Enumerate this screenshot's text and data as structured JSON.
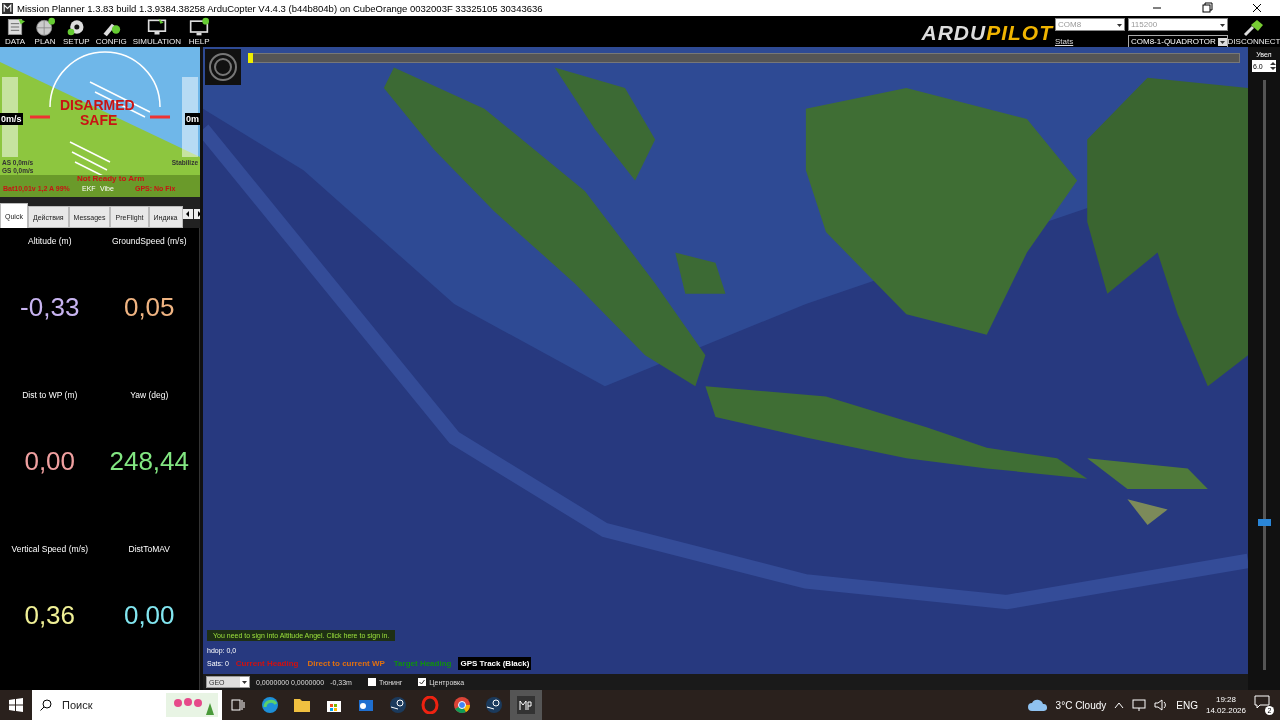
{
  "window": {
    "title": "Mission Planner 1.3.83 build 1.3.9384.38258 ArduCopter V4.4.3 (b44b804b) on CubeOrange 0032003F 33325105 30343636"
  },
  "menu": [
    {
      "label": "DATA",
      "kind": "data"
    },
    {
      "label": "PLAN",
      "kind": "plan"
    },
    {
      "label": "SETUP",
      "kind": "setup"
    },
    {
      "label": "CONFIG",
      "kind": "config"
    },
    {
      "label": "SIMULATION",
      "kind": "simulation"
    },
    {
      "label": "HELP",
      "kind": "help"
    }
  ],
  "connection": {
    "logo_left": "ARDU",
    "logo_right": "PILOT",
    "port": "COM8",
    "baud": "115200",
    "stats": "Stats",
    "vehicle": "COM8-1-QUADROTOR",
    "disconnect": "DISCONNECT"
  },
  "hud": {
    "armed_line1": "DISARMED",
    "armed_line2": "SAFE",
    "speed": "0m/s",
    "alt": "0m",
    "airspeed": "AS 0,0m/s",
    "groundspeed": "GS 0,0m/s",
    "mode": "Stabilize",
    "status": "Not Ready to Arm",
    "battery": "Bat10,01v 1,2 A 99%",
    "ekf": "EKF",
    "vibe": "Vibe",
    "gps": "GPS: No Fix"
  },
  "tabs": [
    {
      "label": "Quick",
      "selected": true
    },
    {
      "label": "Действия",
      "selected": false
    },
    {
      "label": "Messages",
      "selected": false
    },
    {
      "label": "PreFlight",
      "selected": false
    },
    {
      "label": "Индика",
      "selected": false
    }
  ],
  "quick": [
    {
      "label": "Altitude (m)",
      "value": "-0,33",
      "color": "#c8b4f0"
    },
    {
      "label": "GroundSpeed (m/s)",
      "value": "0,05",
      "color": "#f0b482"
    },
    {
      "label": "Dist to WP (m)",
      "value": "0,00",
      "color": "#f0a0a0"
    },
    {
      "label": "Yaw (deg)",
      "value": "248,44",
      "color": "#82e682"
    },
    {
      "label": "Vertical Speed (m/s)",
      "value": "0,36",
      "color": "#f0f096"
    },
    {
      "label": "DistToMAV",
      "value": "0,00",
      "color": "#82e6f0"
    }
  ],
  "map": {
    "altitude_angel": "You need to sign into Altitude Angel. Click here to sign in.",
    "hdop": "hdop: 0,0",
    "sats": "Sats: 0",
    "legend": [
      {
        "label": "Current Heading",
        "color": "#d01010"
      },
      {
        "label": "Direct to current WP",
        "color": "#e07010"
      },
      {
        "label": "Target Heading",
        "color": "#109010"
      },
      {
        "label": "GPS Track (Black)",
        "color": "#000000"
      }
    ],
    "timeline": {
      "level": 0
    },
    "zoom_label": "Увел",
    "zoom_value": "6.0",
    "zoom": {
      "level": 0.25
    }
  },
  "bottom_bar": {
    "coord_system": "GEO",
    "coords": "0,0000000 0,0000000",
    "altitude": "-0,33m",
    "checkboxes": [
      {
        "label": "Тюнинг",
        "checked": false
      },
      {
        "label": "Центровка",
        "checked": true
      }
    ]
  },
  "taskbar": {
    "search_placeholder": "Поиск",
    "weather": "3°C  Cloudy",
    "language": "ENG",
    "time": "19:28",
    "date": "14.02.2026",
    "notifications": "2"
  }
}
